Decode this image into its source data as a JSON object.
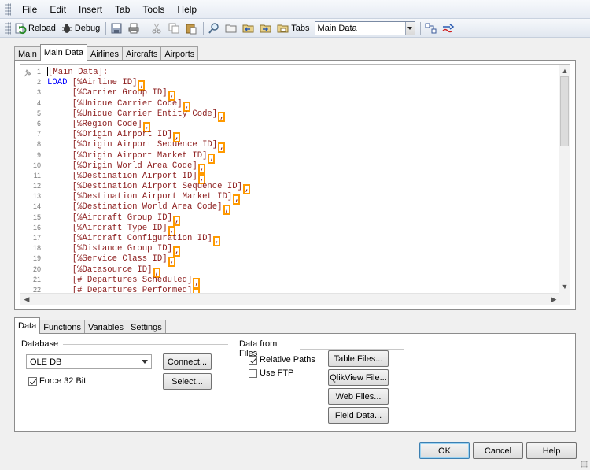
{
  "menubar": {
    "items": [
      "File",
      "Edit",
      "Insert",
      "Tab",
      "Tools",
      "Help"
    ]
  },
  "toolbar": {
    "reload_label": "Reload",
    "debug_label": "Debug",
    "tabs_label": "Tabs",
    "tab_select_value": "Main Data"
  },
  "script_tabs": [
    "Main",
    "Main Data",
    "Airlines",
    "Aircrafts",
    "Airports"
  ],
  "script_active_tab": "Main Data",
  "editor": {
    "lines": [
      {
        "n": "1",
        "text": "[Main Data]:",
        "kw": "",
        "comma": false,
        "caret": true
      },
      {
        "n": "2",
        "text": " [%Airline ID]",
        "kw": "LOAD",
        "comma": true,
        "caret": false
      },
      {
        "n": "3",
        "text": "     [%Carrier Group ID]",
        "kw": "",
        "comma": true,
        "caret": false
      },
      {
        "n": "4",
        "text": "     [%Unique Carrier Code]",
        "kw": "",
        "comma": true,
        "caret": false
      },
      {
        "n": "5",
        "text": "     [%Unique Carrier Entity Code]",
        "kw": "",
        "comma": true,
        "caret": false
      },
      {
        "n": "6",
        "text": "     [%Region Code]",
        "kw": "",
        "comma": true,
        "caret": false
      },
      {
        "n": "7",
        "text": "     [%Origin Airport ID]",
        "kw": "",
        "comma": true,
        "caret": false
      },
      {
        "n": "8",
        "text": "     [%Origin Airport Sequence ID]",
        "kw": "",
        "comma": true,
        "caret": false
      },
      {
        "n": "9",
        "text": "     [%Origin Airport Market ID]",
        "kw": "",
        "comma": true,
        "caret": false
      },
      {
        "n": "10",
        "text": "     [%Origin World Area Code]",
        "kw": "",
        "comma": true,
        "caret": false
      },
      {
        "n": "11",
        "text": "     [%Destination Airport ID]",
        "kw": "",
        "comma": true,
        "caret": false
      },
      {
        "n": "12",
        "text": "     [%Destination Airport Sequence ID]",
        "kw": "",
        "comma": true,
        "caret": false
      },
      {
        "n": "13",
        "text": "     [%Destination Airport Market ID]",
        "kw": "",
        "comma": true,
        "caret": false
      },
      {
        "n": "14",
        "text": "     [%Destination World Area Code]",
        "kw": "",
        "comma": true,
        "caret": false
      },
      {
        "n": "15",
        "text": "     [%Aircraft Group ID]",
        "kw": "",
        "comma": true,
        "caret": false
      },
      {
        "n": "16",
        "text": "     [%Aircraft Type ID]",
        "kw": "",
        "comma": true,
        "caret": false
      },
      {
        "n": "17",
        "text": "     [%Aircraft Configuration ID]",
        "kw": "",
        "comma": true,
        "caret": false
      },
      {
        "n": "18",
        "text": "     [%Distance Group ID]",
        "kw": "",
        "comma": true,
        "caret": false
      },
      {
        "n": "19",
        "text": "     [%Service Class ID]",
        "kw": "",
        "comma": true,
        "caret": false
      },
      {
        "n": "20",
        "text": "     [%Datasource ID]",
        "kw": "",
        "comma": true,
        "caret": false
      },
      {
        "n": "21",
        "text": "     [# Departures Scheduled]",
        "kw": "",
        "comma": true,
        "caret": false
      },
      {
        "n": "22",
        "text": "     [# Departures Performed]",
        "kw": "",
        "comma": true,
        "caret": false
      }
    ]
  },
  "bottom_tabs": [
    "Data",
    "Functions",
    "Variables",
    "Settings"
  ],
  "bottom_active_tab": "Data",
  "database": {
    "group_label": "Database",
    "selected": "OLE DB",
    "connect_label": "Connect...",
    "select_label": "Select...",
    "force32_label": "Force 32 Bit",
    "force32_checked": true
  },
  "files": {
    "group_label": "Data from Files",
    "relative_paths_label": "Relative Paths",
    "relative_paths_checked": true,
    "use_ftp_label": "Use FTP",
    "use_ftp_checked": false,
    "table_files_label": "Table Files...",
    "qlikview_file_label": "QlikView File...",
    "web_files_label": "Web Files...",
    "field_data_label": "Field Data..."
  },
  "dialog": {
    "ok_label": "OK",
    "cancel_label": "Cancel",
    "help_label": "Help"
  },
  "colors": {
    "keyword": "#0000ff",
    "field_text": "#8b1b1b",
    "comma_highlight": "#ff9a00"
  }
}
